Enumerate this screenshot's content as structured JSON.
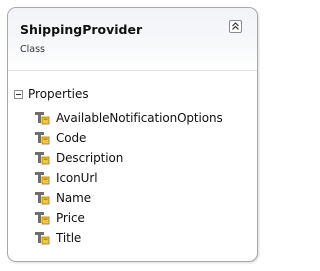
{
  "class": {
    "name": "ShippingProvider",
    "stereotype": "Class"
  },
  "sections": {
    "properties": {
      "label": "Properties",
      "items": [
        {
          "label": "AvailableNotificationOptions",
          "icon": "property-icon"
        },
        {
          "label": "Code",
          "icon": "property-icon"
        },
        {
          "label": "Description",
          "icon": "property-icon"
        },
        {
          "label": "IconUrl",
          "icon": "property-icon"
        },
        {
          "label": "Name",
          "icon": "property-icon"
        },
        {
          "label": "Price",
          "icon": "property-icon"
        },
        {
          "label": "Title",
          "icon": "property-icon"
        }
      ]
    }
  },
  "colors": {
    "border": "#a9a9a9",
    "header_bg": "#f1f3f7",
    "icon_hand": "#5a5a5a",
    "icon_box": "#f2c744"
  }
}
